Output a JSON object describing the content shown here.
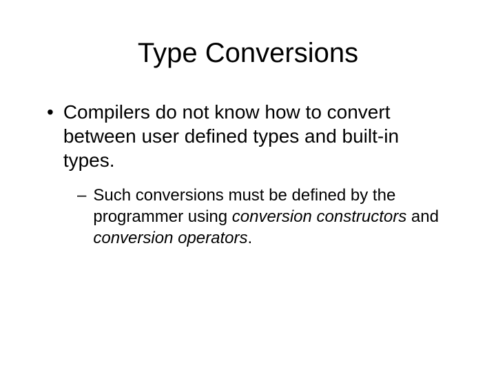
{
  "slide": {
    "title": "Type Conversions",
    "bullet_main": "Compilers do not know how to convert between user defined types and built-in types.",
    "sub_prefix": "Such conversions must be defined by the programmer using ",
    "sub_italic1": "conversion constructors",
    "sub_mid": " and ",
    "sub_italic2": "conversion operators",
    "sub_suffix": "."
  }
}
